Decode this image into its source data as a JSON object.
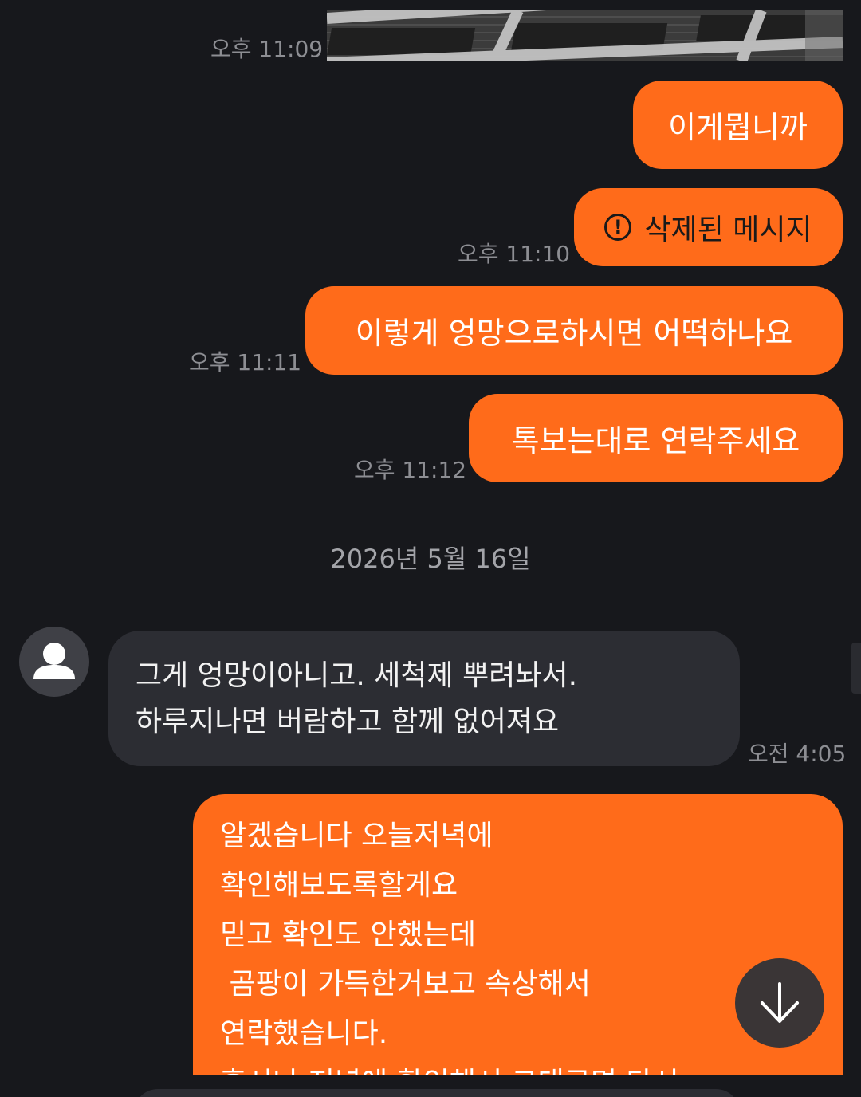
{
  "messages": {
    "m1": {
      "time": "오후 11:09"
    },
    "m2": {
      "text": "이게뭡니까"
    },
    "m3": {
      "text": "삭제된 메시지",
      "time": "오후 11:10",
      "icon": "exclamation-circle-icon"
    },
    "m4": {
      "text": "이렇게 엉망으로하시면 어떡하나요",
      "time": "오후 11:11"
    },
    "m5": {
      "text": "톡보는대로 연락주세요",
      "time": "오후 11:12"
    }
  },
  "date_separator": "2026년 5월 16일",
  "incoming": {
    "avatar_icon": "person-icon",
    "lines": [
      "그게 엉망이아니고. 세척제 뿌려놔서.",
      "하루지나면 버람하고 함께 없어져요"
    ],
    "time": "오전 4:05"
  },
  "reply": {
    "lines": [
      "알겠습니다 오늘저녁에",
      "확인해보도록할게요",
      "믿고 확인도 안했는데",
      " 곰팡이 가득한거보고 속상해서",
      "연락했습니다.",
      "혹시나 저녁에 확인해서 그대로면 다시"
    ]
  },
  "scroll_button": {
    "icon": "arrow-down-icon"
  },
  "colors": {
    "background": "#17181c",
    "outgoing_bubble": "#ff6b1a",
    "incoming_bubble": "#2c2d33",
    "timestamp": "#8d8e93"
  }
}
